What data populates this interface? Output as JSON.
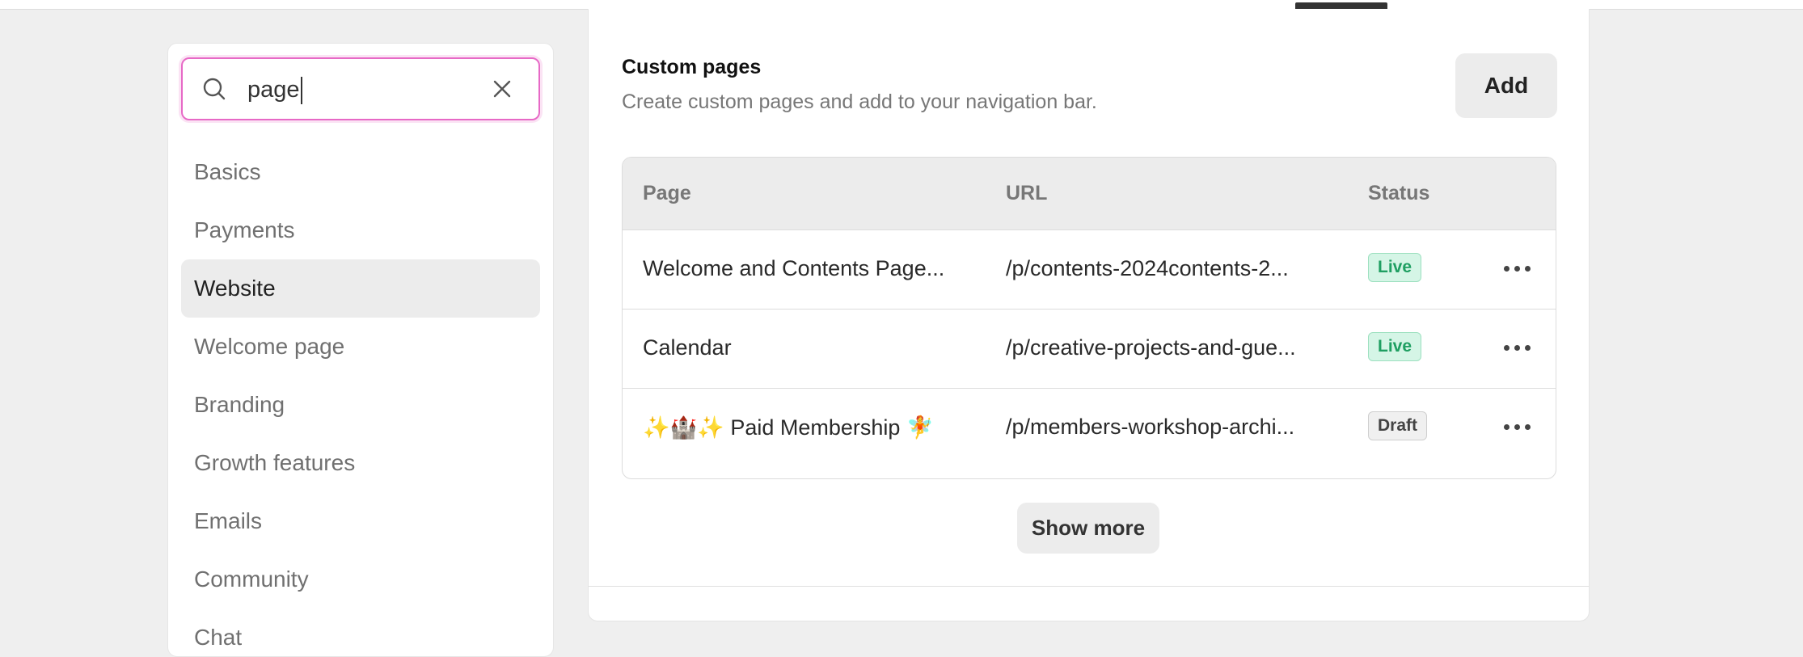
{
  "search": {
    "value": "page",
    "placeholder": "Search"
  },
  "sidebar": {
    "items": [
      {
        "label": "Basics"
      },
      {
        "label": "Payments"
      },
      {
        "label": "Website"
      },
      {
        "label": "Welcome page"
      },
      {
        "label": "Branding"
      },
      {
        "label": "Growth features"
      },
      {
        "label": "Emails"
      },
      {
        "label": "Community"
      },
      {
        "label": "Chat"
      }
    ],
    "active": "Website"
  },
  "section": {
    "title": "Custom pages",
    "subtitle": "Create custom pages and add to your navigation bar.",
    "add_label": "Add"
  },
  "table": {
    "headers": [
      "Page",
      "URL",
      "Status"
    ],
    "rows": [
      {
        "page": "Welcome and Contents Page...",
        "url": "/p/contents-2024contents-2...",
        "status": "Live"
      },
      {
        "page": "Calendar",
        "url": "/p/creative-projects-and-gue...",
        "status": "Live"
      },
      {
        "page": "✨🏰✨ Paid Membership 🧚",
        "url": "/p/members-workshop-archi...",
        "status": "Draft"
      }
    ]
  },
  "show_more_label": "Show more",
  "colors": {
    "focus": "#e769c6",
    "live_bg": "#d5f5e6",
    "live_text": "#1f9f62"
  }
}
